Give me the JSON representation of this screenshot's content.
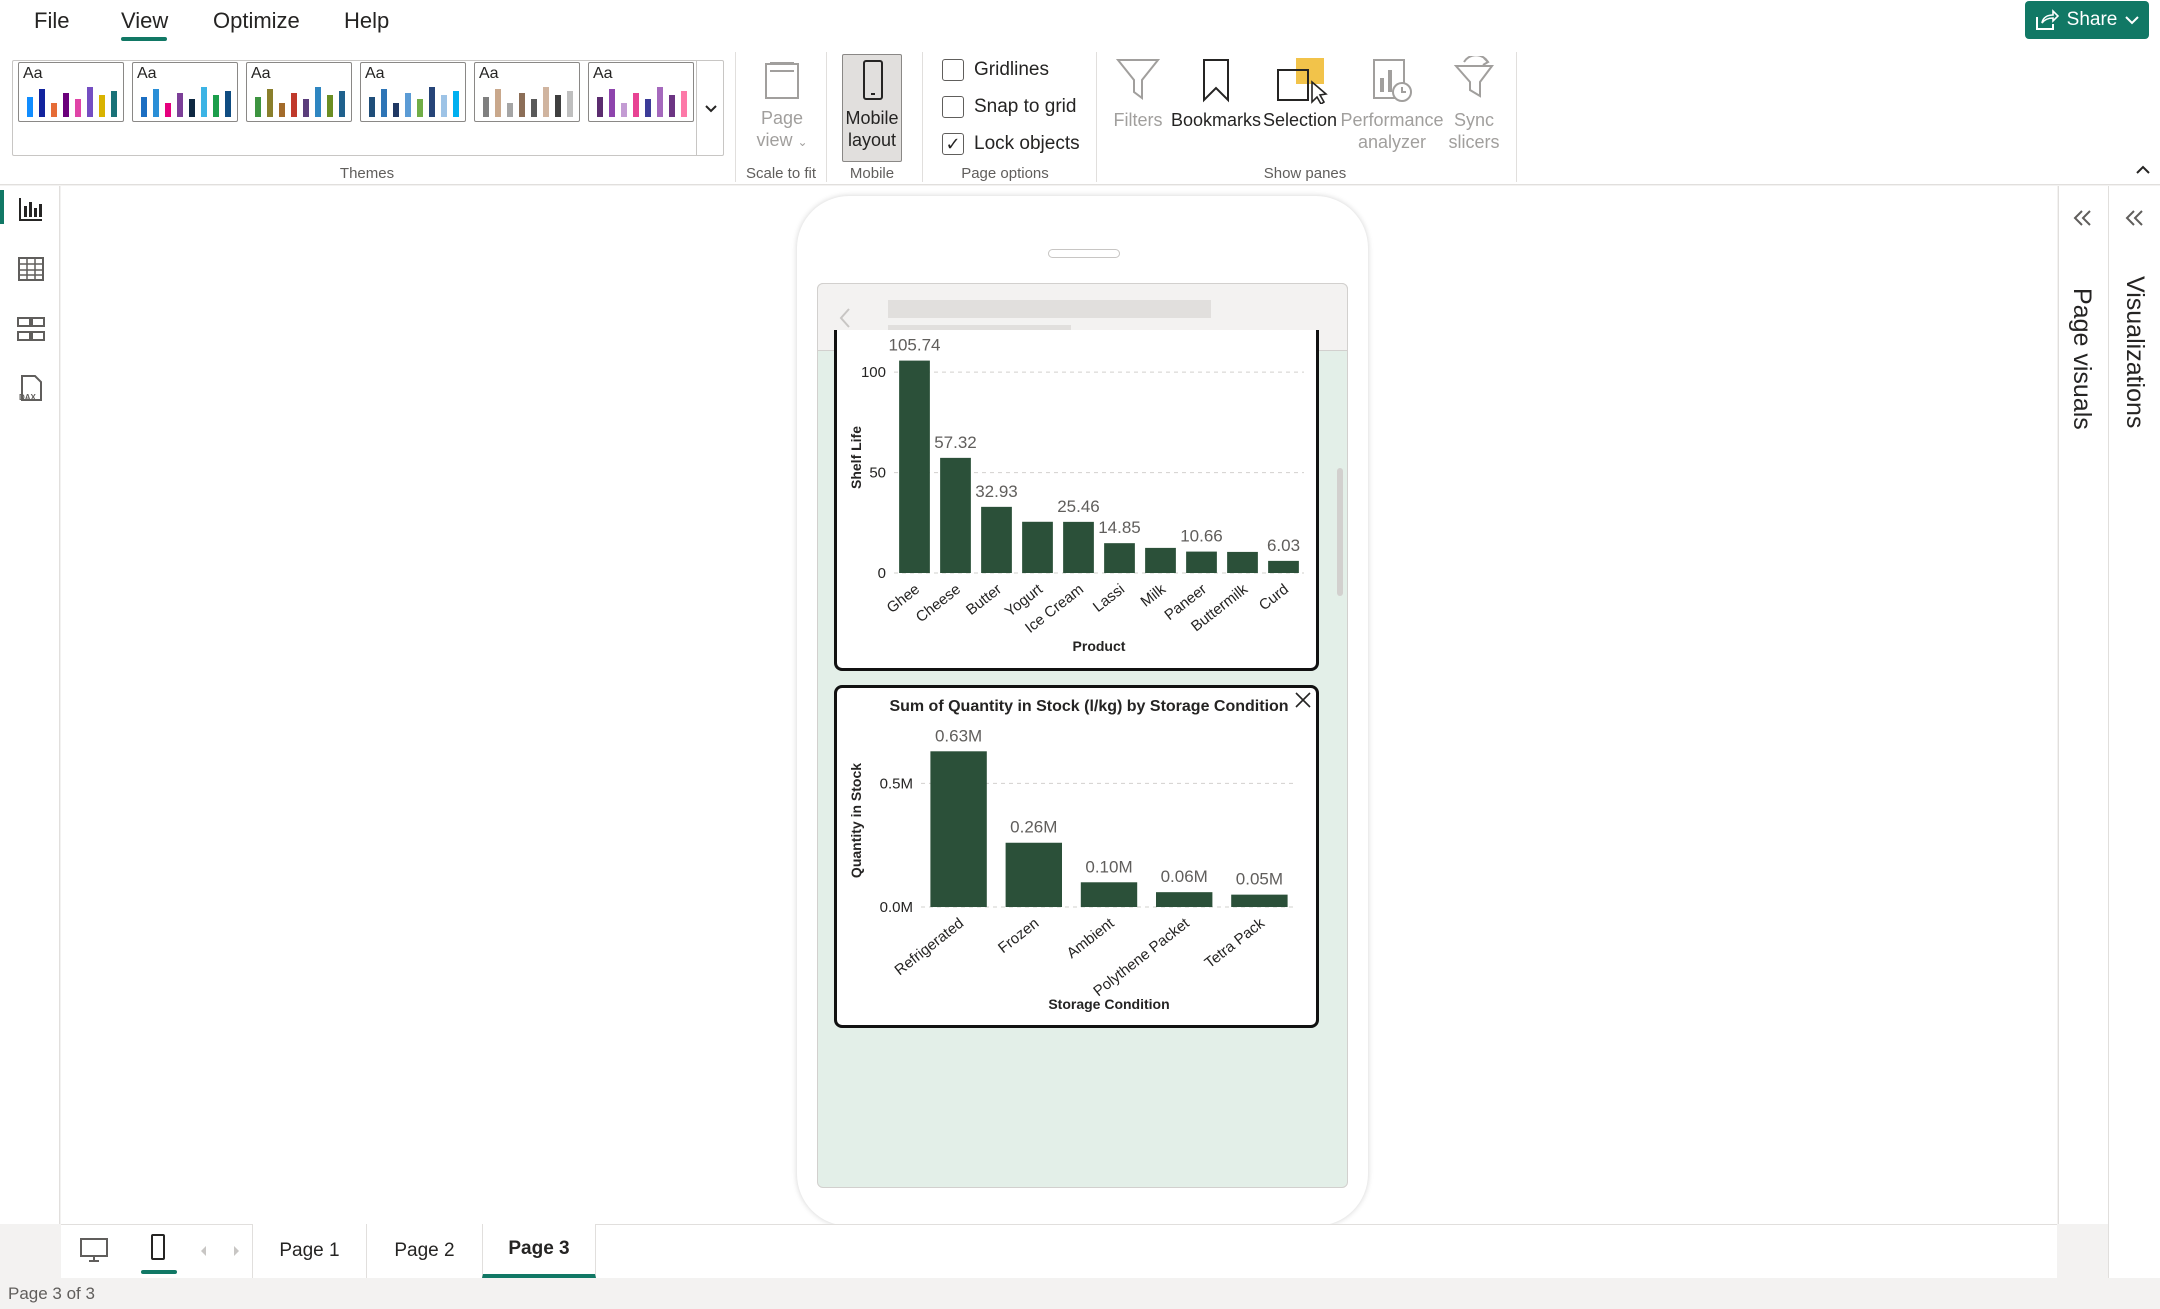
{
  "menu": {
    "items": [
      {
        "label": "File",
        "active": false
      },
      {
        "label": "View",
        "active": true
      },
      {
        "label": "Optimize",
        "active": false
      },
      {
        "label": "Help",
        "active": false
      }
    ]
  },
  "share": {
    "label": "Share"
  },
  "ribbon": {
    "themes": {
      "label": "Themes",
      "items": [
        {
          "aa": "Aa",
          "colors": [
            "#118DFF",
            "#12239E",
            "#E66C37",
            "#6B007B",
            "#E044A7",
            "#744EC2",
            "#D9B300",
            "#197278"
          ]
        },
        {
          "aa": "Aa",
          "colors": [
            "#1B6EC2",
            "#2A8FD7",
            "#E6007E",
            "#7C3F98",
            "#0E2841",
            "#3CB4E5",
            "#1B9E4B",
            "#0F4C81"
          ]
        },
        {
          "aa": "Aa",
          "colors": [
            "#3D9440",
            "#8A7F2C",
            "#A36B2B",
            "#C0392B",
            "#5A3D7B",
            "#2E86C1",
            "#6B8E23",
            "#1F618D"
          ]
        },
        {
          "aa": "Aa",
          "colors": [
            "#1F4E79",
            "#2E75B6",
            "#203864",
            "#5B9BD5",
            "#70AD47",
            "#264478",
            "#9DC3E6",
            "#00B0F0"
          ]
        },
        {
          "aa": "Aa",
          "colors": [
            "#7F7F7F",
            "#C9A88C",
            "#A5A5A5",
            "#8C6E57",
            "#595959",
            "#D0B49F",
            "#3F3F3F",
            "#BFBFBF"
          ]
        },
        {
          "aa": "Aa",
          "colors": [
            "#5B2C6F",
            "#8E44AD",
            "#C39BD3",
            "#E84393",
            "#3B3B98",
            "#A569BD",
            "#6C3483",
            "#FD79A8"
          ]
        }
      ]
    },
    "scale_to_fit": {
      "label": "Scale to fit",
      "button_line1": "Page",
      "button_line2": "view"
    },
    "mobile": {
      "label": "Mobile",
      "button_line1": "Mobile",
      "button_line2": "layout"
    },
    "page_options": {
      "label": "Page options",
      "gridlines": {
        "label": "Gridlines",
        "checked": false
      },
      "snap_to_grid": {
        "label": "Snap to grid",
        "checked": false
      },
      "lock_objects": {
        "label": "Lock objects",
        "checked": true
      }
    },
    "show_panes": {
      "label": "Show panes",
      "filters": "Filters",
      "bookmarks": "Bookmarks",
      "selection": "Selection",
      "performance_line1": "Performance",
      "performance_line2": "analyzer",
      "sync_line1": "Sync",
      "sync_line2": "slicers"
    }
  },
  "panes": {
    "page_visuals": "Page visuals",
    "visualizations": "Visualizations"
  },
  "chart_data": [
    {
      "type": "bar",
      "title": "",
      "xlabel": "Product",
      "ylabel": "Shelf Life",
      "categories": [
        "Ghee",
        "Cheese",
        "Butter",
        "Yogurt",
        "Ice Cream",
        "Lassi",
        "Milk",
        "Paneer",
        "Buttermilk",
        "Curd"
      ],
      "values": [
        105.74,
        57.32,
        32.93,
        25.5,
        25.46,
        14.85,
        12.5,
        10.66,
        10.5,
        6.03
      ],
      "data_labels": [
        "105.74",
        "57.32",
        "32.93",
        "",
        "25.46",
        "14.85",
        "",
        "10.66",
        "",
        "6.03"
      ],
      "yticks": [
        "0",
        "50",
        "100"
      ],
      "ylim": [
        0,
        115
      ],
      "color": "#2b5039",
      "grid": true
    },
    {
      "type": "bar",
      "title": "Sum of Quantity in Stock (l/kg) by Storage Condition",
      "xlabel": "Storage Condition",
      "ylabel": "Quantity in Stock",
      "categories": [
        "Refrigerated",
        "Frozen",
        "Ambient",
        "Polythene Packet",
        "Tetra Pack"
      ],
      "values": [
        0.63,
        0.26,
        0.1,
        0.06,
        0.05
      ],
      "data_labels": [
        "0.63M",
        "0.26M",
        "0.10M",
        "0.06M",
        "0.05M"
      ],
      "yticks": [
        "0.0M",
        "0.5M"
      ],
      "ylim": [
        0,
        0.7
      ],
      "color": "#2b5039",
      "grid": true
    }
  ],
  "pages": {
    "tabs": [
      "Page 1",
      "Page 2",
      "Page 3"
    ],
    "active": 2
  },
  "status": {
    "text": "Page 3 of 3"
  }
}
